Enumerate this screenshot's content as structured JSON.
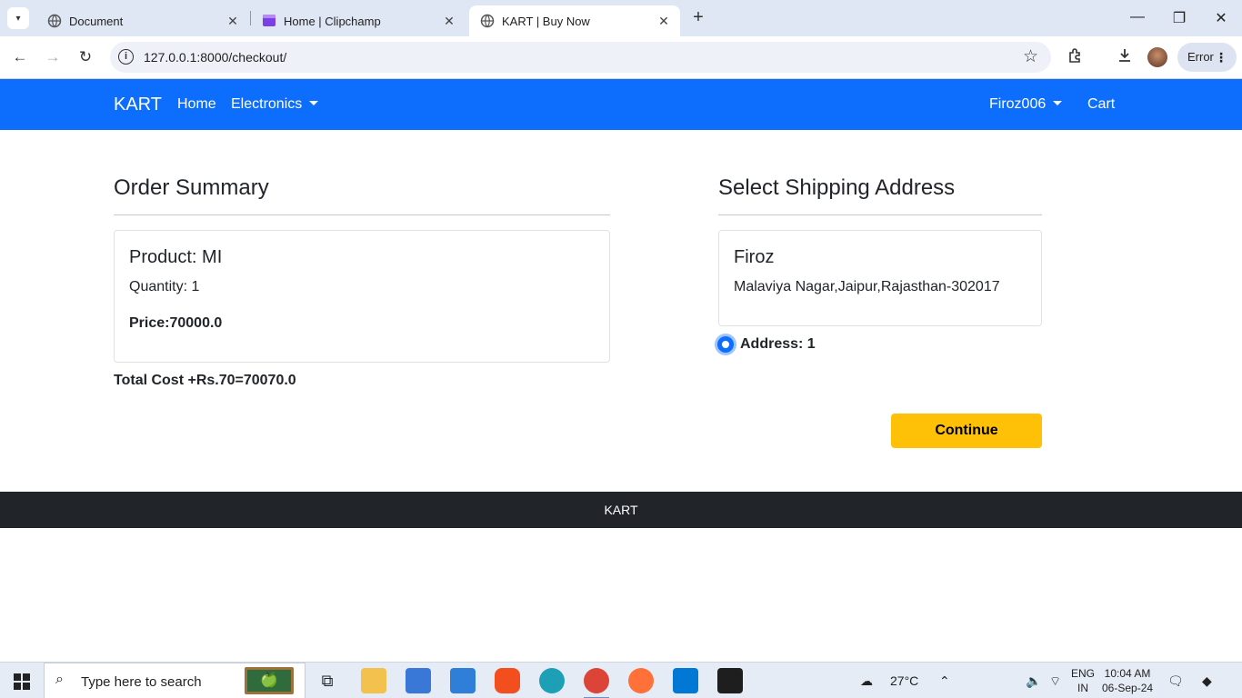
{
  "browser": {
    "tabs": [
      {
        "title": "Document",
        "active": false
      },
      {
        "title": "Home | Clipchamp",
        "active": false
      },
      {
        "title": "KART | Buy Now",
        "active": true
      }
    ],
    "url": "127.0.0.1:8000/checkout/",
    "profile_status": "Error"
  },
  "site": {
    "brand": "KART",
    "nav": {
      "home": "Home",
      "electronics": "Electronics",
      "user": "Firoz006",
      "cart": "Cart"
    },
    "accent_color": "#0d6efd"
  },
  "order_summary": {
    "heading": "Order Summary",
    "product": "Product: MI",
    "quantity": "Quantity: 1",
    "price": "Price:70000.0",
    "total": "Total Cost +Rs.70=70070.0"
  },
  "shipping": {
    "heading": "Select Shipping Address",
    "name": "Firoz",
    "address": "Malaviya Nagar,Jaipur,Rajasthan-302017",
    "radio_label": "Address: 1",
    "selected": true
  },
  "continue_label": "Continue",
  "footer_text": "KART",
  "taskbar": {
    "search_placeholder": "Type here to search",
    "temperature": "27°C",
    "lang_1": "ENG",
    "lang_2": "IN",
    "time": "10:04 AM",
    "date": "06-Sep-24"
  }
}
